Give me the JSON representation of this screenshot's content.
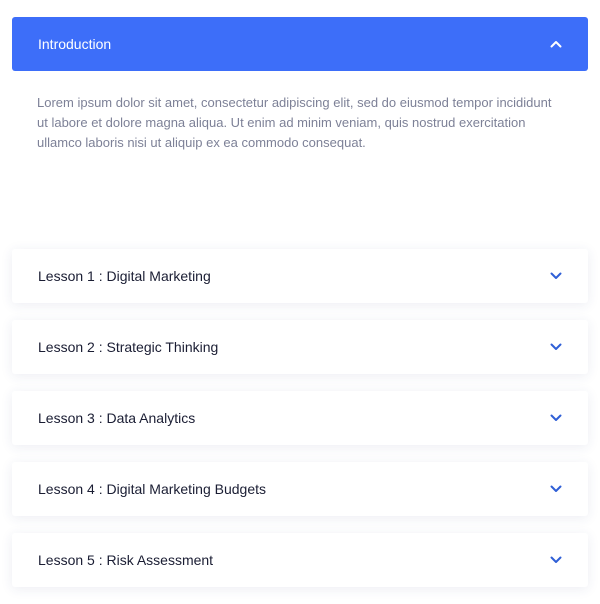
{
  "accordion": {
    "active": {
      "title": "Introduction",
      "body": "Lorem ipsum dolor sit amet, consectetur adipiscing elit, sed do eiusmod tempor incididunt ut labore et dolore magna aliqua. Ut enim ad minim veniam, quis nostrud exercitation ullamco laboris nisi ut aliquip ex ea commodo consequat."
    },
    "lessons": [
      {
        "title": "Lesson 1 : Digital Marketing"
      },
      {
        "title": "Lesson 2 : Strategic Thinking"
      },
      {
        "title": "Lesson 3 : Data Analytics"
      },
      {
        "title": "Lesson 4 : Digital Marketing Budgets"
      },
      {
        "title": "Lesson 5 : Risk Assessment"
      }
    ],
    "icons": {
      "expanded": "chevron-up-icon",
      "collapsed": "chevron-down-icon"
    }
  },
  "colors": {
    "accent": "#3d6ef9",
    "chevron": "#2f5fd6",
    "body_text": "#7d8197",
    "title_text": "#1a1d33"
  }
}
